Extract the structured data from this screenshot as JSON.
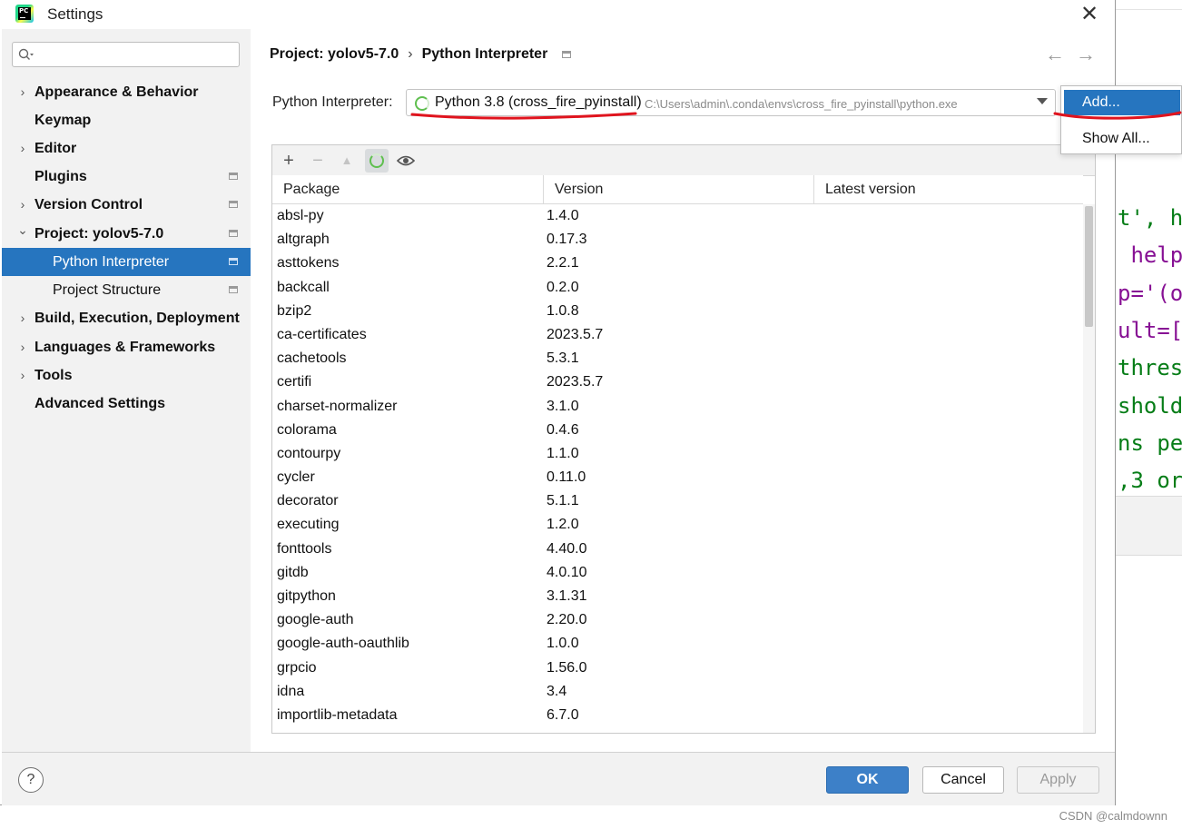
{
  "window": {
    "title": "Settings",
    "close_glyph": "✕"
  },
  "search": {
    "placeholder": ""
  },
  "sidebar": {
    "items": [
      {
        "label": "Appearance & Behavior",
        "expandable": true
      },
      {
        "label": "Keymap"
      },
      {
        "label": "Editor",
        "expandable": true
      },
      {
        "label": "Plugins",
        "project_icon": true
      },
      {
        "label": "Version Control",
        "expandable": true,
        "project_icon": true
      },
      {
        "label": "Project: yolov5-7.0",
        "expanded": true,
        "project_icon": true
      },
      {
        "label": "Python Interpreter",
        "selected": true,
        "project_icon": true
      },
      {
        "label": "Project Structure",
        "project_icon": true
      },
      {
        "label": "Build, Execution, Deployment",
        "expandable": true
      },
      {
        "label": "Languages & Frameworks",
        "expandable": true
      },
      {
        "label": "Tools",
        "expandable": true
      },
      {
        "label": "Advanced Settings"
      }
    ]
  },
  "breadcrumb": {
    "project": "Project: yolov5-7.0",
    "separator": "›",
    "page": "Python Interpreter"
  },
  "nav": {
    "back": "←",
    "forward": "→"
  },
  "interpreter": {
    "label": "Python Interpreter:",
    "name": "Python 3.8 (cross_fire_pyinstall)",
    "path": "C:\\Users\\admin\\.conda\\envs\\cross_fire_pyinstall\\python.exe"
  },
  "popup": {
    "add": "Add...",
    "show_all": "Show All..."
  },
  "toolbar": {
    "add": "+",
    "remove": "−",
    "upgrade": "▲",
    "show_early": "👁"
  },
  "table": {
    "columns": [
      "Package",
      "Version",
      "Latest version"
    ],
    "rows": [
      [
        "absl-py",
        "1.4.0",
        ""
      ],
      [
        "altgraph",
        "0.17.3",
        ""
      ],
      [
        "asttokens",
        "2.2.1",
        ""
      ],
      [
        "backcall",
        "0.2.0",
        ""
      ],
      [
        "bzip2",
        "1.0.8",
        ""
      ],
      [
        "ca-certificates",
        "2023.5.7",
        ""
      ],
      [
        "cachetools",
        "5.3.1",
        ""
      ],
      [
        "certifi",
        "2023.5.7",
        ""
      ],
      [
        "charset-normalizer",
        "3.1.0",
        ""
      ],
      [
        "colorama",
        "0.4.6",
        ""
      ],
      [
        "contourpy",
        "1.1.0",
        ""
      ],
      [
        "cycler",
        "0.11.0",
        ""
      ],
      [
        "decorator",
        "5.1.1",
        ""
      ],
      [
        "executing",
        "1.2.0",
        ""
      ],
      [
        "fonttools",
        "4.40.0",
        ""
      ],
      [
        "gitdb",
        "4.0.10",
        ""
      ],
      [
        "gitpython",
        "3.1.31",
        ""
      ],
      [
        "google-auth",
        "2.20.0",
        ""
      ],
      [
        "google-auth-oauthlib",
        "1.0.0",
        ""
      ],
      [
        "grpcio",
        "1.56.0",
        ""
      ],
      [
        "idna",
        "3.4",
        ""
      ],
      [
        "importlib-metadata",
        "6.7.0",
        ""
      ]
    ]
  },
  "footer": {
    "help": "?",
    "ok": "OK",
    "cancel": "Cancel",
    "apply": "Apply"
  },
  "background_editor": {
    "lines": [
      {
        "text": "t', h",
        "color": "#067d17"
      },
      {
        "text": " help",
        "color": "#871094"
      },
      {
        "text": "p='(o",
        "color": "#871094"
      },
      {
        "text": "ult=[",
        "color": "#871094"
      },
      {
        "text": "thres",
        "color": "#067d17"
      },
      {
        "text": "shold",
        "color": "#067d17"
      },
      {
        "text": "ns pe",
        "color": "#067d17"
      },
      {
        "text": ",3 or",
        "color": "#067d17"
      }
    ]
  },
  "watermark": "CSDN @calmdownn",
  "colors": {
    "accent": "#2675bf",
    "annotation": "#e0141e",
    "ok_button": "#3d80c8"
  }
}
